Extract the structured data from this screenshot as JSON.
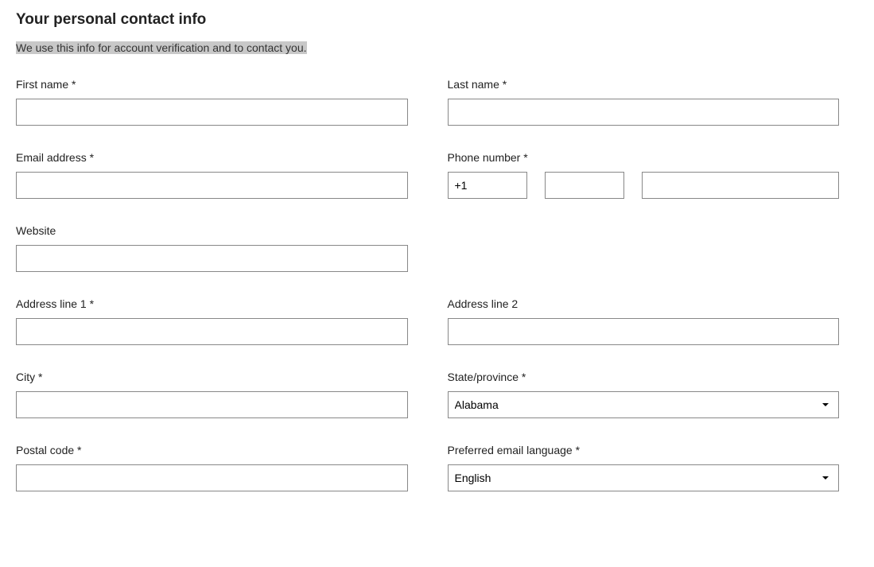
{
  "heading": "Your personal contact info",
  "subtext": "We use this info for account verification and to contact you.",
  "labels": {
    "first_name": "First name *",
    "last_name": "Last name *",
    "email": "Email address *",
    "phone": "Phone number *",
    "website": "Website",
    "address1": "Address line 1 *",
    "address2": "Address line 2",
    "city": "City *",
    "state": "State/province *",
    "postal": "Postal code *",
    "language": "Preferred email language *"
  },
  "values": {
    "first_name": "",
    "last_name": "",
    "email": "",
    "phone_country": "+1",
    "phone_area": "",
    "phone_number": "",
    "website": "",
    "address1": "",
    "address2": "",
    "city": "",
    "state": "Alabama",
    "postal": "",
    "language": "English"
  }
}
